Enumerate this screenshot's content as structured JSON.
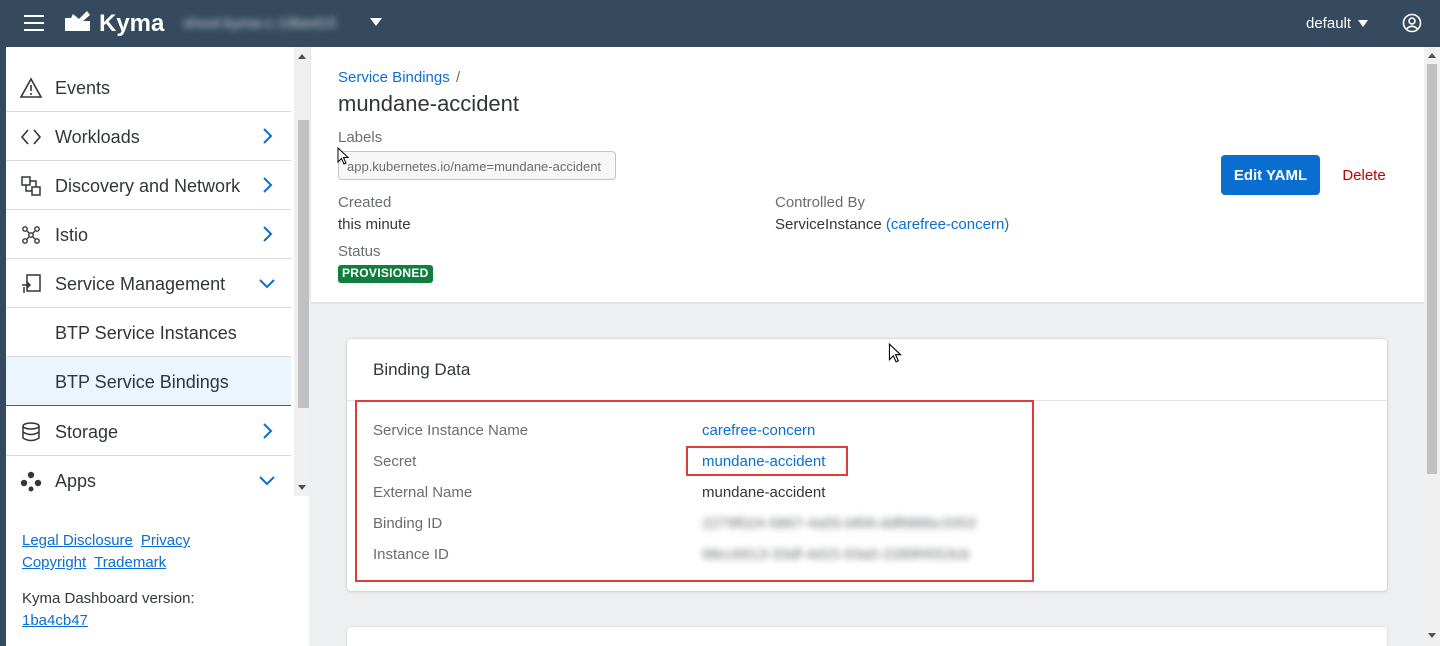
{
  "shell": {
    "brand": "Kyma",
    "cluster": "shoot-kyma-c-19bed15",
    "namespace": "default"
  },
  "sidebar": {
    "items": [
      {
        "label": "Events",
        "icon": "warning-triangle-icon"
      },
      {
        "label": "Workloads",
        "icon": "code-brackets-icon",
        "expandable": true
      },
      {
        "label": "Discovery and Network",
        "icon": "network-icon",
        "expandable": true
      },
      {
        "label": "Istio",
        "icon": "istio-mesh-icon",
        "expandable": true
      },
      {
        "label": "Service Management",
        "icon": "service-management-icon",
        "expanded": true
      },
      {
        "label": "BTP Service Instances",
        "sub": true
      },
      {
        "label": "BTP Service Bindings",
        "sub": true,
        "selected": true
      },
      {
        "label": "Storage",
        "icon": "storage-icon",
        "expandable": true
      },
      {
        "label": "Apps",
        "icon": "apps-icon",
        "expanded": true
      }
    ],
    "footer": {
      "legal": "Legal Disclosure",
      "privacy": "Privacy",
      "copyright": "Copyright",
      "trademark": "Trademark",
      "version_label": "Kyma Dashboard version:",
      "version": "1ba4cb47"
    }
  },
  "header": {
    "breadcrumb": "Service Bindings",
    "breadcrumb_sep": "/",
    "title": "mundane-accident",
    "labels_caption": "Labels",
    "label_token": "app.kubernetes.io/name=mundane-accident",
    "created_caption": "Created",
    "created_value": "this minute",
    "status_caption": "Status",
    "status_value": "PROVISIONED",
    "controlled_caption": "Controlled By",
    "controlled_kind": "ServiceInstance",
    "controlled_link": "(carefree-concern)",
    "edit_label": "Edit YAML",
    "delete_label": "Delete"
  },
  "binding": {
    "title": "Binding Data",
    "rows": [
      {
        "key": "Service Instance Name",
        "value": "carefree-concern"
      },
      {
        "key": "Secret",
        "value": "mundane-accident"
      },
      {
        "key": "External Name",
        "value": "mundane-accident"
      },
      {
        "key": "Binding ID",
        "value": "2279f024-5867-4a55-bf06-ddf686bc3353"
      },
      {
        "key": "Instance ID",
        "value": "68cc6913-33df-4d15-93a0-2289f4553cb"
      }
    ]
  },
  "colors": {
    "shell": "#354a5f",
    "link": "#0a6ed1",
    "positive": "#107e3e",
    "negative": "#bb0000",
    "highlight": "#e03c3c"
  }
}
